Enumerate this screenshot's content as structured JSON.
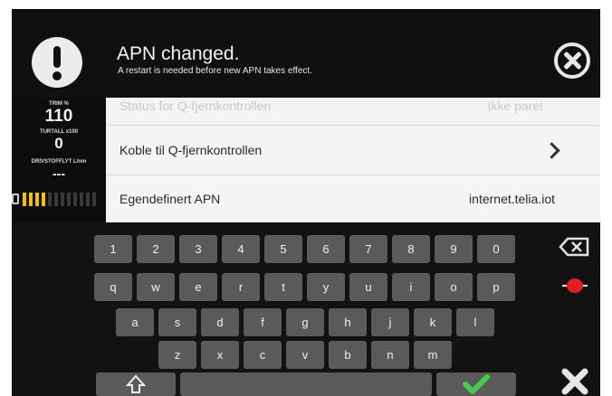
{
  "notification": {
    "title": "APN changed.",
    "message": "A restart is needed before new APN takes effect."
  },
  "gauges": {
    "trim_label": "TRIM %",
    "trim_value": "110",
    "rpm_label": "TURTALL x100",
    "rpm_value": "0",
    "fuel_label": "DRIVSTOFFLYT L/nm",
    "fuel_value": "---",
    "battery_segments_total": 12,
    "battery_segments_filled": 4,
    "battery_color": "#f2c200"
  },
  "settings": {
    "rows": [
      {
        "label": "Status for Q-fjernkontrollen",
        "value": "Ikke paret"
      },
      {
        "label": "Koble til Q-fjernkontrollen",
        "value": ""
      },
      {
        "label": "Egendefinert APN",
        "value": "internet.telia.iot"
      }
    ]
  },
  "keyboard": {
    "row1": [
      "1",
      "2",
      "3",
      "4",
      "5",
      "6",
      "7",
      "8",
      "9",
      "0"
    ],
    "row2": [
      "q",
      "w",
      "e",
      "r",
      "t",
      "y",
      "u",
      "i",
      "o",
      "p"
    ],
    "row3": [
      "a",
      "s",
      "d",
      "f",
      "g",
      "h",
      "j",
      "k",
      "l"
    ],
    "row4": [
      "z",
      "x",
      "c",
      "v",
      "b",
      "n",
      "m"
    ]
  },
  "colors": {
    "accept": "#4cc94c",
    "language_icon": "#e02020"
  }
}
